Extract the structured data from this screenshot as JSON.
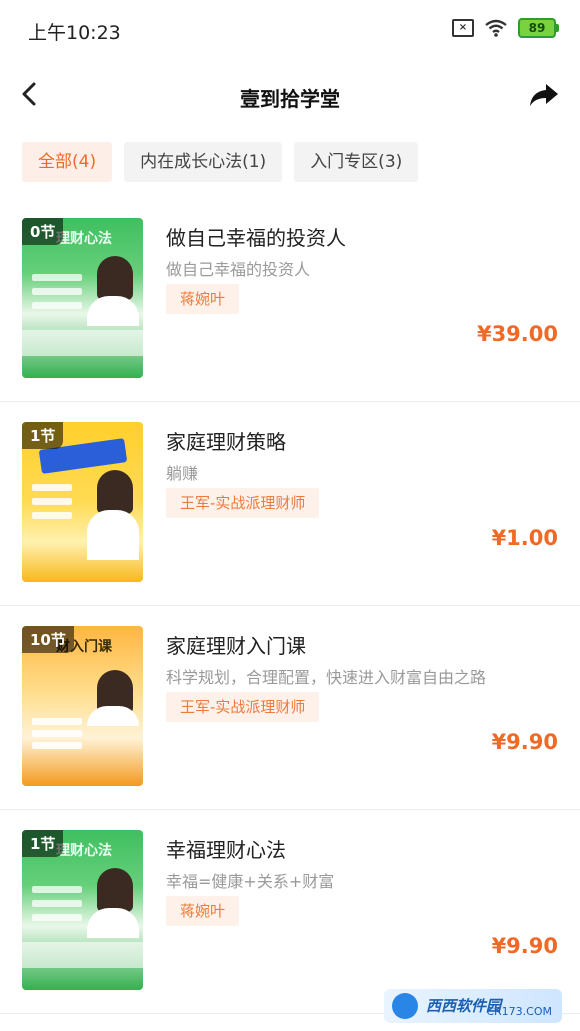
{
  "status_bar": {
    "time": "上午10:23",
    "battery": "89",
    "icons": [
      "sim-off-icon",
      "wifi-icon",
      "battery-icon"
    ]
  },
  "nav": {
    "title": "壹到拾学堂",
    "back_icon": "chevron-left-icon",
    "share_icon": "share-arrow-icon"
  },
  "tabs": [
    {
      "label": "全部(4)",
      "active": true
    },
    {
      "label": "内在成长心法(1)",
      "active": false
    },
    {
      "label": "入门专区(3)",
      "active": false
    }
  ],
  "courses": [
    {
      "lessons": "0节",
      "thumb_text": "理财心法",
      "title": "做自己幸福的投资人",
      "subtitle": "做自己幸福的投资人",
      "teacher": "蒋婉叶",
      "price": "¥39.00",
      "theme": "green"
    },
    {
      "lessons": "1节",
      "thumb_text": "",
      "title": "家庭理财策略",
      "subtitle": "躺赚",
      "teacher": "王军-实战派理财师",
      "price": "¥1.00",
      "theme": "yellow"
    },
    {
      "lessons": "10节",
      "thumb_text": "财入门课",
      "title": "家庭理财入门课",
      "subtitle": "科学规划，合理配置，快速进入财富自由之路",
      "teacher": "王军-实战派理财师",
      "price": "¥9.90",
      "theme": "orange"
    },
    {
      "lessons": "1节",
      "thumb_text": "理财心法",
      "title": "幸福理财心法",
      "subtitle": "幸福=健康+关系+财富",
      "teacher": "蒋婉叶",
      "price": "¥9.90",
      "theme": "green"
    }
  ],
  "watermark": {
    "name": "西西软件园",
    "url": "CR173.COM"
  },
  "colors": {
    "accent": "#ef6a2a",
    "price": "#f06a25",
    "tag_bg": "#fdf1ea"
  }
}
